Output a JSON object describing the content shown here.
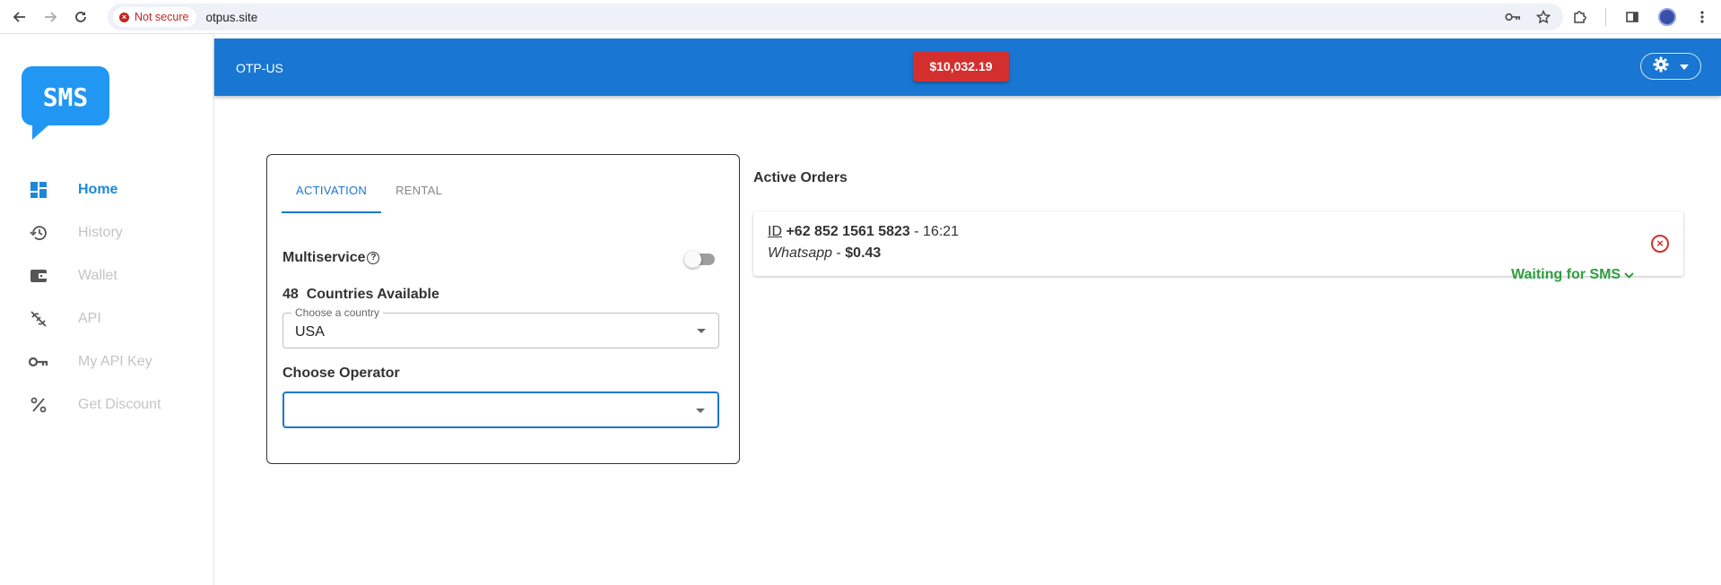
{
  "browser": {
    "security_label": "Not secure",
    "url": "otpus.site"
  },
  "logo": {
    "text": "SMS",
    "color": "#2196f3"
  },
  "sidebar": {
    "items": [
      {
        "label": "Home",
        "icon": "dashboard-icon",
        "active": true
      },
      {
        "label": "History",
        "icon": "history-icon",
        "active": false
      },
      {
        "label": "Wallet",
        "icon": "wallet-icon",
        "active": false
      },
      {
        "label": "API",
        "icon": "link-off-icon",
        "active": false
      },
      {
        "label": "My API Key",
        "icon": "key-icon",
        "active": false
      },
      {
        "label": "Get Discount",
        "icon": "percent-icon",
        "active": false
      }
    ]
  },
  "header": {
    "title": "OTP-US",
    "balance": "$10,032.19",
    "colors": {
      "bar": "#1976d2",
      "balance": "#d32f2f"
    }
  },
  "order_form": {
    "tabs": [
      {
        "label": "ACTIVATION",
        "active": true
      },
      {
        "label": "RENTAL",
        "active": false
      }
    ],
    "multiservice_label": "Multiservice",
    "multiservice_enabled": false,
    "countries_count": "48",
    "countries_label": "Countries Available",
    "country_field_label": "Choose a country",
    "country_value": "USA",
    "operator_label": "Choose Operator",
    "operator_value": ""
  },
  "active_orders": {
    "title": "Active Orders",
    "orders": [
      {
        "id_label": "ID",
        "phone": "+62 852 1561 5823",
        "separator": "-",
        "time": "16:21",
        "service": "Whatsapp",
        "price": "$0.43",
        "status": "Waiting for SMS",
        "status_color": "#2e9e3e"
      }
    ]
  }
}
